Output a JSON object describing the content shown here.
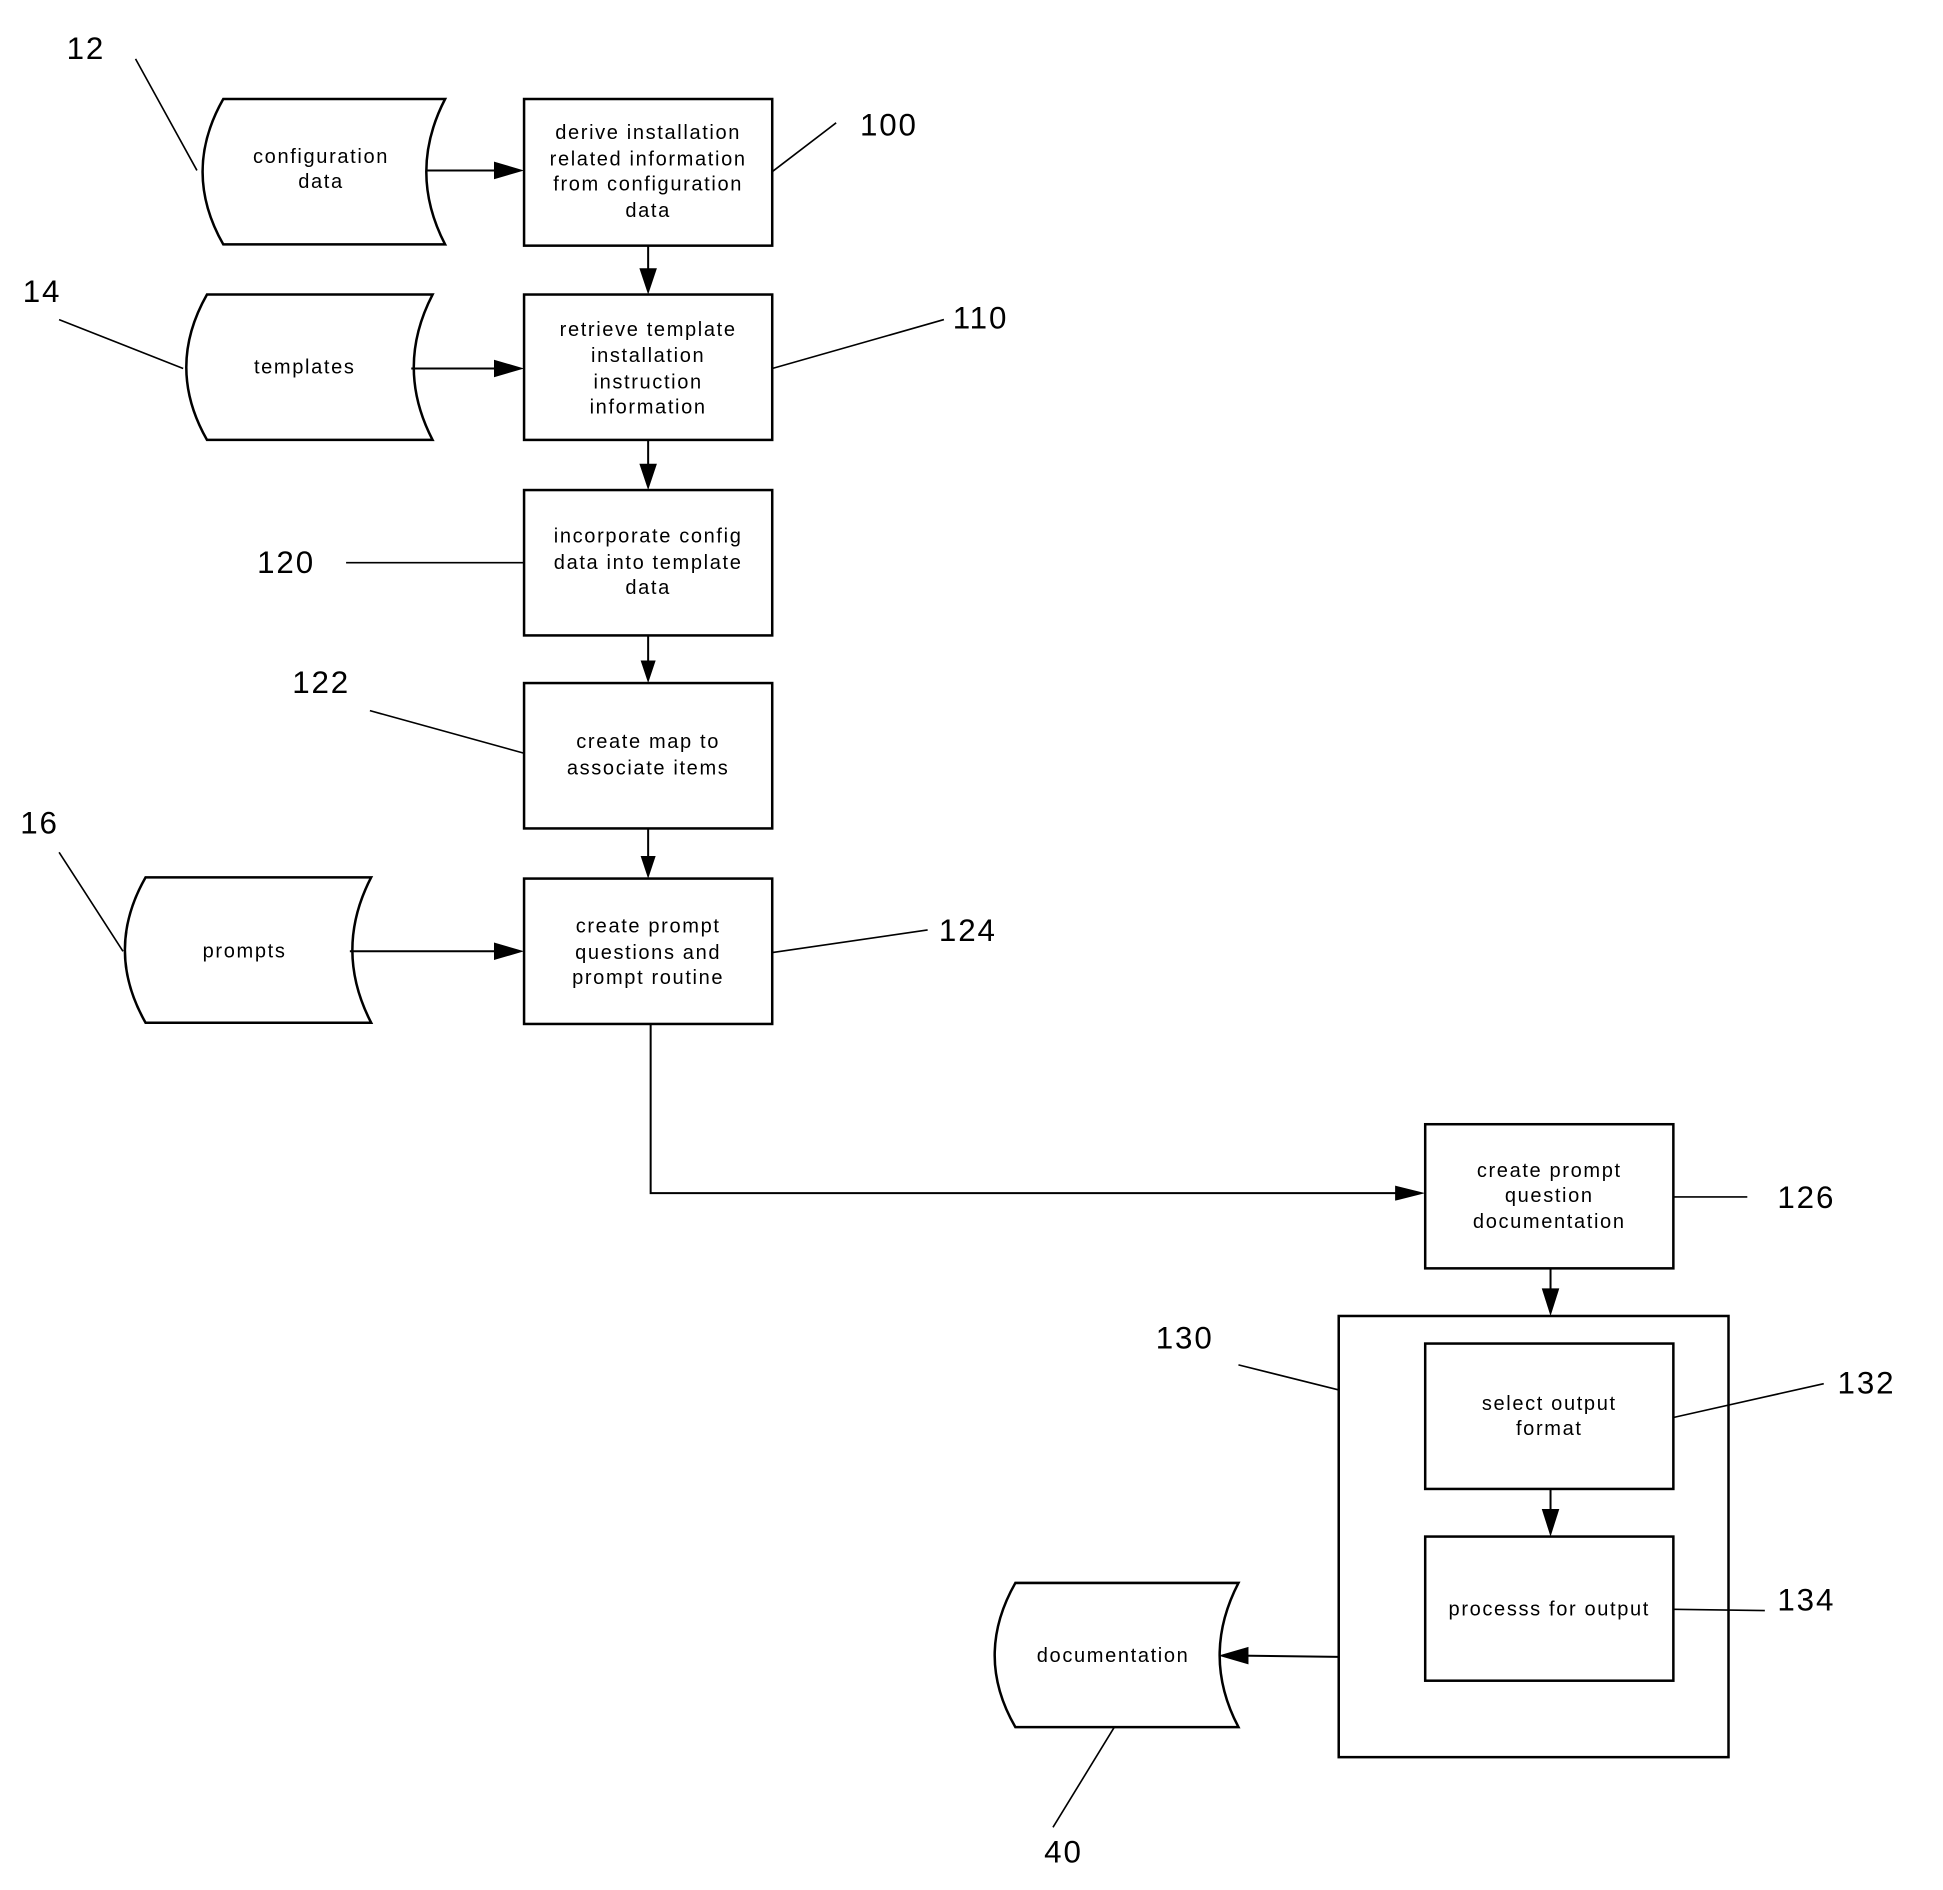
{
  "figure": {
    "process_steps": [
      {
        "id": "100",
        "lines": [
          "derive installation",
          "related information",
          "from configuration",
          "data"
        ]
      },
      {
        "id": "110",
        "lines": [
          "retrieve template",
          "installation",
          "instruction",
          "information"
        ]
      },
      {
        "id": "120",
        "lines": [
          "incorporate config",
          "data into template",
          "data"
        ]
      },
      {
        "id": "122",
        "lines": [
          "create map to",
          "associate items"
        ]
      },
      {
        "id": "124",
        "lines": [
          "create prompt",
          "questions and",
          "prompt routine"
        ]
      },
      {
        "id": "126",
        "lines": [
          "create prompt",
          "question",
          "documentation"
        ]
      },
      {
        "id": "132",
        "lines": [
          "select output",
          "format"
        ]
      },
      {
        "id": "134",
        "lines": [
          "processs for output"
        ]
      }
    ],
    "group": {
      "id": "130"
    },
    "data_stores": [
      {
        "id": "12",
        "lines": [
          "configuration",
          "data"
        ]
      },
      {
        "id": "14",
        "lines": [
          "templates"
        ]
      },
      {
        "id": "16",
        "lines": [
          "prompts"
        ]
      },
      {
        "id": "40",
        "lines": [
          "documentation"
        ]
      }
    ],
    "reference_numerals": [
      "12",
      "14",
      "16",
      "40",
      "100",
      "110",
      "120",
      "122",
      "124",
      "126",
      "130",
      "132",
      "134"
    ]
  }
}
